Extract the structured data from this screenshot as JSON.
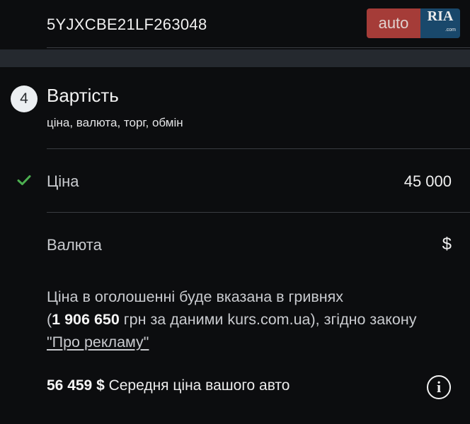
{
  "vin": {
    "value": "5YJXCBE21LF263048"
  },
  "watermark": {
    "auto": "auto",
    "ria": "RIA",
    "ria_small": ".com"
  },
  "section": {
    "step_number": "4",
    "title": "Вартість",
    "subtitle": "ціна, валюта, торг, обмін"
  },
  "price_row": {
    "label": "Ціна",
    "value": "45 000",
    "status": "filled",
    "check_color": "#4caf50"
  },
  "currency_row": {
    "label": "Валюта",
    "value": "$"
  },
  "info": {
    "line1": "Ціна в оголошенні буде вказана в гривнях",
    "paren_open": "(",
    "uah_amount": "1 906 650",
    "line2_rest": " грн за даними kurs.com.ua), згідно закону",
    "law_link": "\"Про рекламу\""
  },
  "average": {
    "amount": "56 459 $",
    "label": " Середня ціна вашого авто",
    "icon": "info-icon"
  }
}
